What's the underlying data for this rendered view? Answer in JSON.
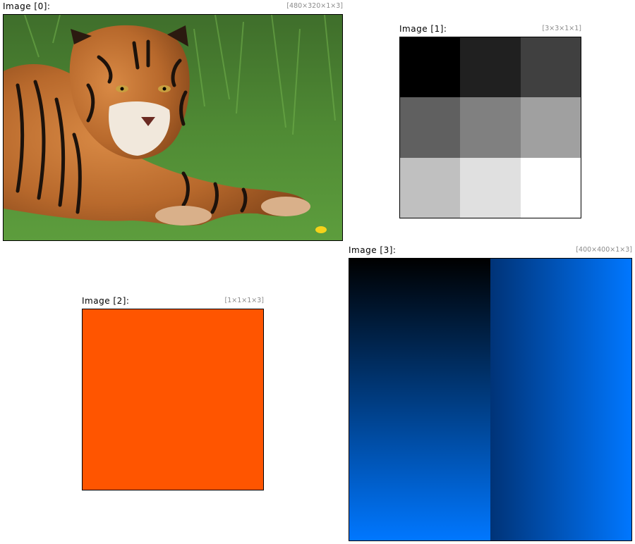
{
  "images": [
    {
      "title": "Image [0]:",
      "dims": "[480×320×1×3]",
      "content": "tiger-photo"
    },
    {
      "title": "Image [1]:",
      "dims": "[3×3×1×1]",
      "pixels": [
        "#000000",
        "#202020",
        "#404040",
        "#606060",
        "#808080",
        "#a0a0a0",
        "#c0c0c0",
        "#e0e0e0",
        "#ffffff"
      ]
    },
    {
      "title": "Image [2]:",
      "dims": "[1×1×1×3]",
      "color": "#ff5500"
    },
    {
      "title": "Image [3]:",
      "dims": "[400×400×1×3]",
      "gradient_left": {
        "from": "#000000",
        "to": "#0077ff",
        "direction": "vertical"
      },
      "gradient_right": {
        "from": "#003377",
        "to": "#0077ff",
        "direction": "horizontal"
      }
    }
  ]
}
